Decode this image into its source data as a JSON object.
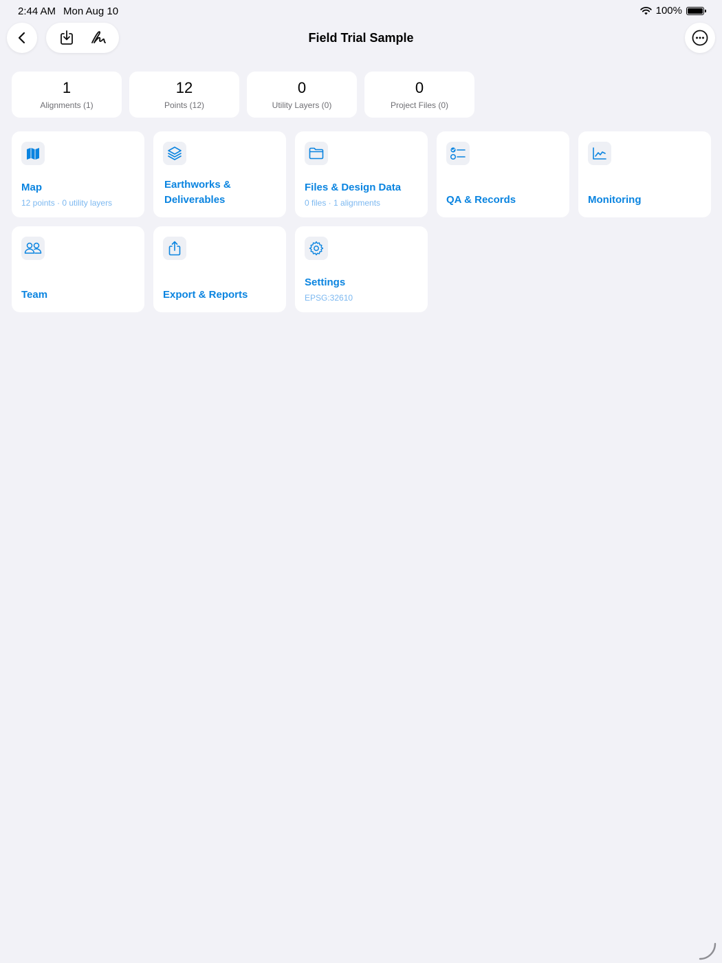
{
  "status_bar": {
    "time": "2:44 AM",
    "date": "Mon Aug 10",
    "battery": "100%"
  },
  "nav": {
    "title": "Field Trial Sample",
    "icons": [
      "back-chevron-icon",
      "download-tray-icon",
      "signature-icon",
      "more-ellipsis-icon"
    ]
  },
  "stats": [
    {
      "value": "1",
      "label": "Alignments (1)"
    },
    {
      "value": "12",
      "label": "Points (12)"
    },
    {
      "value": "0",
      "label": "Utility Layers (0)"
    },
    {
      "value": "0",
      "label": "Project Files (0)"
    }
  ],
  "tiles": [
    {
      "title": "Map",
      "subtitle": "12 points · 0 utility layers",
      "icon": "map-icon"
    },
    {
      "title": "Earthworks & Deliverables",
      "subtitle": "",
      "icon": "layers-icon"
    },
    {
      "title": "Files & Design Data",
      "subtitle": "0 files · 1 alignments",
      "icon": "folder-icon"
    },
    {
      "title": "QA & Records",
      "subtitle": "",
      "icon": "checklist-icon"
    },
    {
      "title": "Monitoring",
      "subtitle": "",
      "icon": "line-chart-icon"
    },
    {
      "title": "Team",
      "subtitle": "",
      "icon": "people-icon"
    },
    {
      "title": "Export & Reports",
      "subtitle": "",
      "icon": "share-icon"
    },
    {
      "title": "Settings",
      "subtitle": "EPSG:32610",
      "icon": "gear-icon"
    }
  ],
  "colors": {
    "background": "#f2f2f7",
    "accent": "#0a84e0",
    "accent_light": "#7cb8f0",
    "card": "#ffffff"
  }
}
